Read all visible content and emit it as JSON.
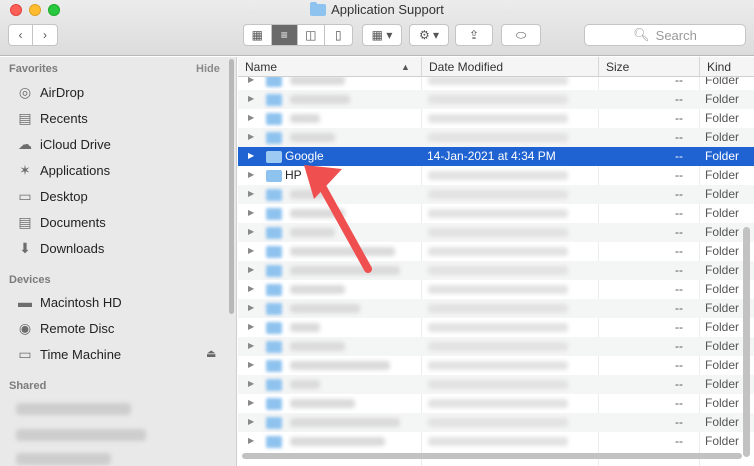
{
  "window": {
    "title": "Application Support"
  },
  "toolbar": {
    "search_placeholder": "Search"
  },
  "sidebar": {
    "favorites_label": "Favorites",
    "hide_label": "Hide",
    "favorites": [
      {
        "label": "AirDrop",
        "icon": "airdrop-icon"
      },
      {
        "label": "Recents",
        "icon": "recents-icon"
      },
      {
        "label": "iCloud Drive",
        "icon": "cloud-icon"
      },
      {
        "label": "Applications",
        "icon": "applications-icon"
      },
      {
        "label": "Desktop",
        "icon": "desktop-icon"
      },
      {
        "label": "Documents",
        "icon": "documents-icon"
      },
      {
        "label": "Downloads",
        "icon": "downloads-icon"
      }
    ],
    "devices_label": "Devices",
    "devices": [
      {
        "label": "Macintosh HD",
        "icon": "hard-drive-icon"
      },
      {
        "label": "Remote Disc",
        "icon": "disc-icon"
      },
      {
        "label": "Time Machine",
        "icon": "time-machine-icon"
      }
    ],
    "shared_label": "Shared"
  },
  "columns": {
    "name": "Name",
    "date_modified": "Date Modified",
    "size": "Size",
    "kind": "Kind"
  },
  "selected_row": {
    "name": "Google",
    "date": "14-Jan-2021 at 4:34 PM",
    "size": "--",
    "kind": "Folder"
  },
  "partial_row": {
    "name": "HP"
  },
  "common": {
    "dash": "--",
    "folder": "Folder"
  },
  "colors": {
    "selection": "#1f62d1",
    "annotation_arrow": "#ef4f4f"
  }
}
